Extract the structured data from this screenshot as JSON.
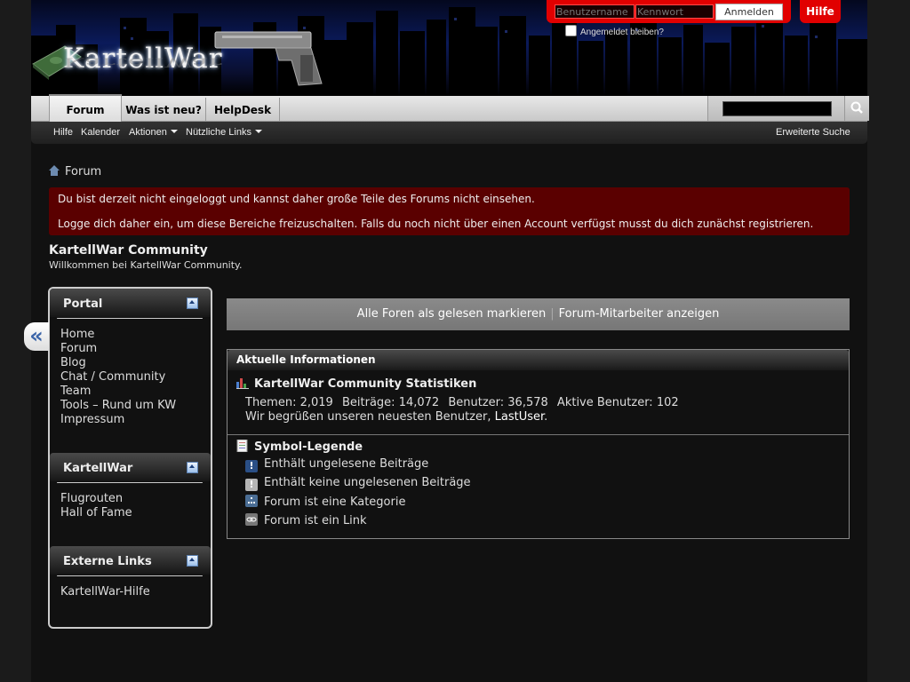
{
  "header": {
    "logo_text": "KartellWar",
    "username_placeholder": "Benutzername",
    "password_placeholder": "Kennwort",
    "login_button": "Anmelden",
    "remember_label": "Angemeldet bleiben?",
    "help_button": "Hilfe",
    "accent_color": "#e10000"
  },
  "navbar": {
    "tabs": [
      {
        "label": "Forum",
        "active": true
      },
      {
        "label": "Was ist neu?"
      },
      {
        "label": "HelpDesk"
      }
    ],
    "search_icon": "magnifier-icon"
  },
  "subnav": {
    "items": [
      "Hilfe",
      "Kalender",
      "Aktionen",
      "Nützliche Links"
    ],
    "advanced_search": "Erweiterte Suche"
  },
  "breadcrumb": {
    "home_icon": "home-icon",
    "current": "Forum"
  },
  "notice": {
    "line1": "Du bist derzeit nicht eingeloggt und kannst daher große Teile des Forums nicht einsehen.",
    "line2": "Logge dich daher ein, um diese Bereiche freizuschalten. Falls du noch nicht über einen Account verfügst musst du dich zunächst registrieren."
  },
  "page": {
    "title": "KartellWar Community",
    "subtitle": "Willkommen bei KartellWar Community."
  },
  "sidebar": {
    "collapse_glyph": "«",
    "sections": [
      {
        "title": "Portal",
        "items": [
          "Home",
          "Forum",
          "Blog",
          "Chat / Community",
          "Team",
          "Tools – Rund um KW",
          "Impressum"
        ]
      },
      {
        "title": "KartellWar",
        "items": [
          "Flugrouten",
          "Hall of Fame"
        ]
      },
      {
        "title": "Externe Links",
        "items": [
          "KartellWar-Hilfe"
        ]
      }
    ]
  },
  "main": {
    "mark_read": "Alle Foren als gelesen markieren",
    "separator": "|",
    "show_staff": "Forum-Mitarbeiter anzeigen",
    "info_header": "Aktuelle Informationen",
    "stats_title": "KartellWar Community Statistiken",
    "stats": {
      "threads_label": "Themen:",
      "threads": "2,019",
      "posts_label": "Beiträge:",
      "posts": "14,072",
      "users_label": "Benutzer:",
      "users": "36,578",
      "active_label": "Aktive Benutzer:",
      "active": "102",
      "welcome_prefix": "Wir begrüßen unseren neuesten Benutzer,",
      "newest_user": "LastUser",
      "welcome_suffix": "."
    },
    "legend_title": "Symbol-Legende",
    "legend": [
      {
        "icon": "unread-posts-icon",
        "label": "Enthält ungelesene Beiträge"
      },
      {
        "icon": "no-unread-posts-icon",
        "label": "Enthält keine ungelesenen Beiträge"
      },
      {
        "icon": "category-icon",
        "label": "Forum ist eine Kategorie"
      },
      {
        "icon": "link-icon",
        "label": "Forum ist ein Link"
      }
    ]
  }
}
